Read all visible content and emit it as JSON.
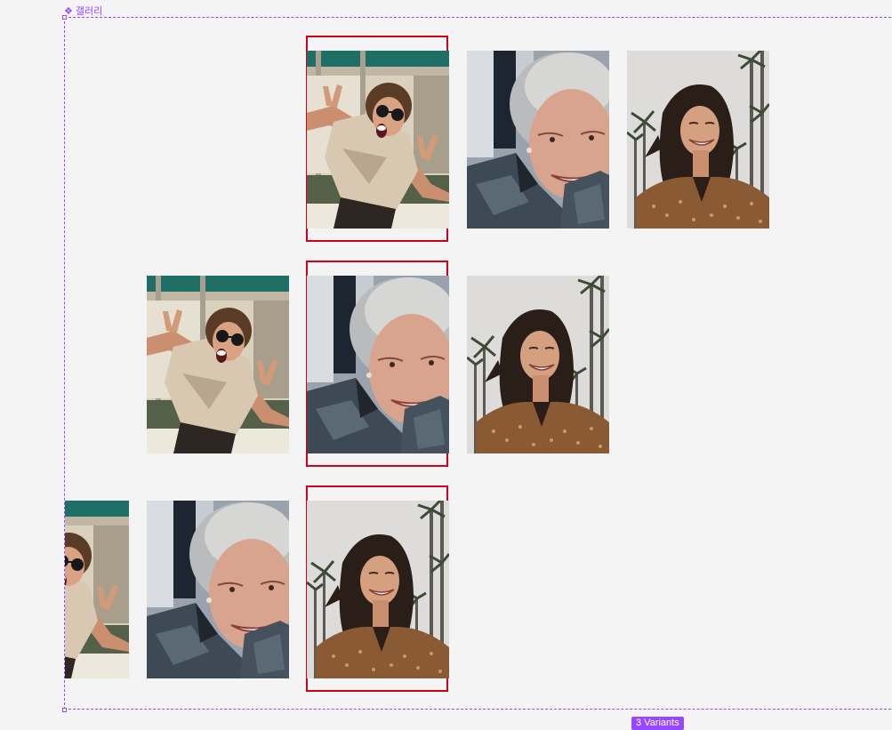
{
  "component": {
    "name": "갤러리",
    "icon": "component-icon",
    "variants_label": "3 Variants"
  },
  "colors": {
    "accent": "#9747ff",
    "selection": "#d0021b",
    "canvas": "#f5f4f4"
  },
  "variants": [
    {
      "name": "variant-1",
      "photos": [
        "young-woman-sunglasses-photo",
        "elderly-woman-smiling-photo",
        "woman-palm-trees-photo"
      ]
    },
    {
      "name": "variant-2",
      "photos": [
        "young-woman-sunglasses-photo",
        "elderly-woman-smiling-photo",
        "woman-palm-trees-photo"
      ]
    },
    {
      "name": "variant-3",
      "photos": [
        "young-woman-sunglasses-photo",
        "elderly-woman-smiling-photo",
        "woman-palm-trees-photo"
      ]
    }
  ]
}
